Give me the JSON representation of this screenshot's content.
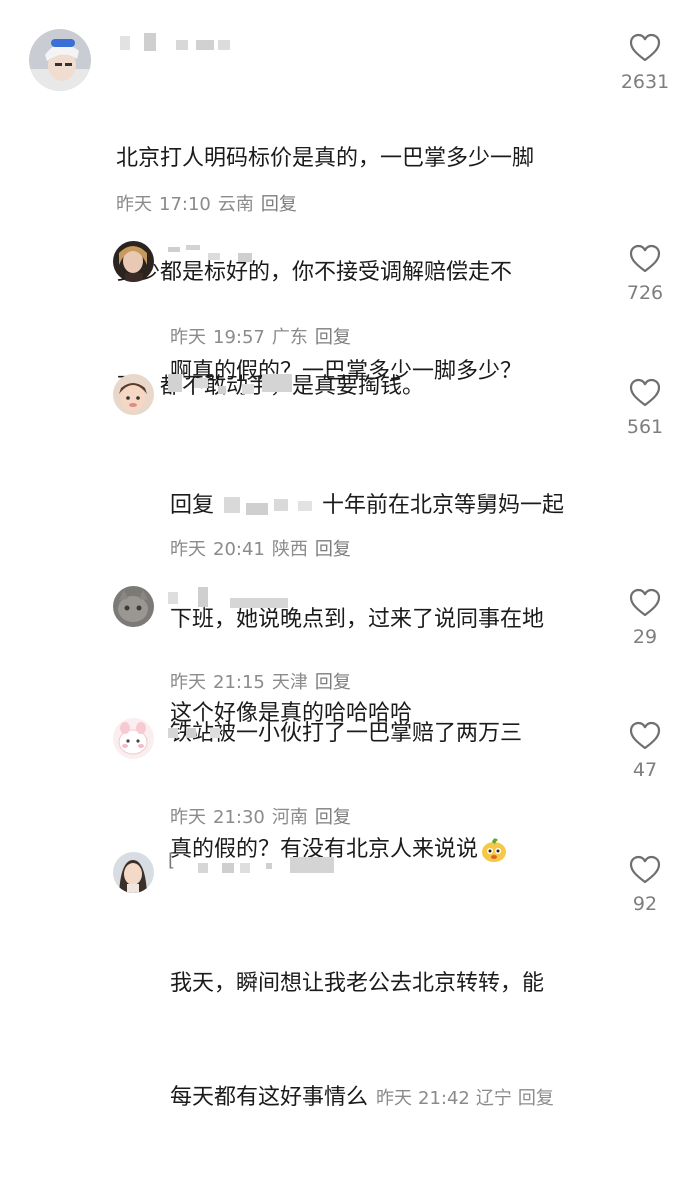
{
  "comments": [
    {
      "text_lines": [
        "北京打人明码标价是真的，一巴掌多少一脚",
        "多少都是标好的，你不接受调解赔偿走不",
        "了。都不敢动手，是真要掏钱。"
      ],
      "date": "昨天",
      "time": "17:10",
      "location": "云南",
      "reply": "回复",
      "likes": "2631"
    },
    {
      "text_lines": [
        "啊真的假的？一巴掌多少一脚多少？"
      ],
      "date": "昨天",
      "time": "19:57",
      "location": "广东",
      "reply": "回复",
      "likes": "726"
    },
    {
      "reply_prefix": "回复",
      "text_lines": [
        "十年前在北京等舅妈一起",
        "下班，她说晚点到，过来了说同事在地",
        "铁站被一小伙打了一巴掌赔了两万三"
      ],
      "date": "昨天",
      "time": "20:41",
      "location": "陕西",
      "reply": "回复",
      "likes": "561"
    },
    {
      "text_lines": [
        "这个好像是真的哈哈哈哈"
      ],
      "date": "昨天",
      "time": "21:15",
      "location": "天津",
      "reply": "回复",
      "likes": "29"
    },
    {
      "text_lines": [
        "真的假的？有没有北京人来说说"
      ],
      "emoji": "dog-face-emoji",
      "date": "昨天",
      "time": "21:30",
      "location": "河南",
      "reply": "回复",
      "likes": "47"
    },
    {
      "name_prefix": "[",
      "text_lines": [
        "我天，瞬间想让我老公去北京转转，能",
        "每天都有这好事情么"
      ],
      "date": "昨天",
      "time": "21:42",
      "location": "辽宁",
      "reply": "回复",
      "likes": "92"
    }
  ],
  "icons": {
    "like": "heart-outline-icon"
  },
  "colors": {
    "meta": "#8b8b8b",
    "text": "#1b1b1b",
    "redaction": "#d4d4d4"
  }
}
